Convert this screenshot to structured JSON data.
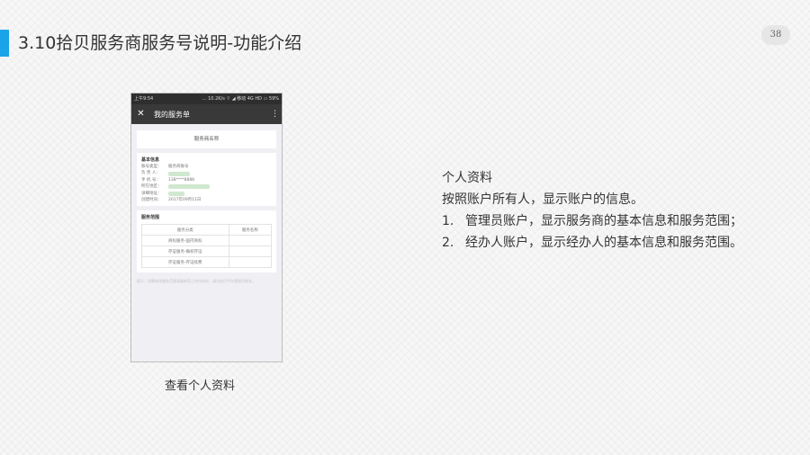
{
  "slide": {
    "title": "3.10拾贝服务商服务号说明-功能介绍",
    "page_number": "38",
    "accent_color": "#1aa3e8"
  },
  "phone": {
    "status_bar": {
      "left": "上午9:54",
      "right": "… 10.2K/s ⌔ ◢ 移动 4G HD ▭ 59%"
    },
    "nav": {
      "close_icon": "close-icon",
      "title": "我的服务单",
      "menu_icon": "more-vertical-icon"
    },
    "name_card": "服务商名称",
    "basic_info": {
      "title": "基本信息",
      "rows": [
        {
          "key": "账号类型：",
          "value": "服务商账号"
        },
        {
          "key": "负 责 人：",
          "value": ""
        },
        {
          "key": "手 机 号：",
          "value": "138****8888"
        },
        {
          "key": "所在地区：",
          "value": ""
        },
        {
          "key": "详细地址：",
          "value": ""
        },
        {
          "key": "创建时间：",
          "value": "2017年09月11日"
        }
      ]
    },
    "scope": {
      "title": "服务范围",
      "headers": [
        "服务分类",
        "服务名称"
      ],
      "rows": [
        [
          "商标服务-国内商标",
          ""
        ],
        [
          "存证服务-确权存证",
          ""
        ],
        [
          "存证服务-存证续费",
          ""
        ]
      ]
    },
    "tip": "提示：如需修改服务范围请重新签订合作协议，请与拾贝平台管理员联系。"
  },
  "caption": "查看个人资料",
  "description": {
    "heading": "个人资料",
    "intro": "按照账户所有人，显示账户的信息。",
    "items": [
      {
        "num": "1.",
        "text": "管理员账户，显示服务商的基本信息和服务范围；"
      },
      {
        "num": "2.",
        "text": "经办人账户，显示经办人的基本信息和服务范围。"
      }
    ]
  }
}
